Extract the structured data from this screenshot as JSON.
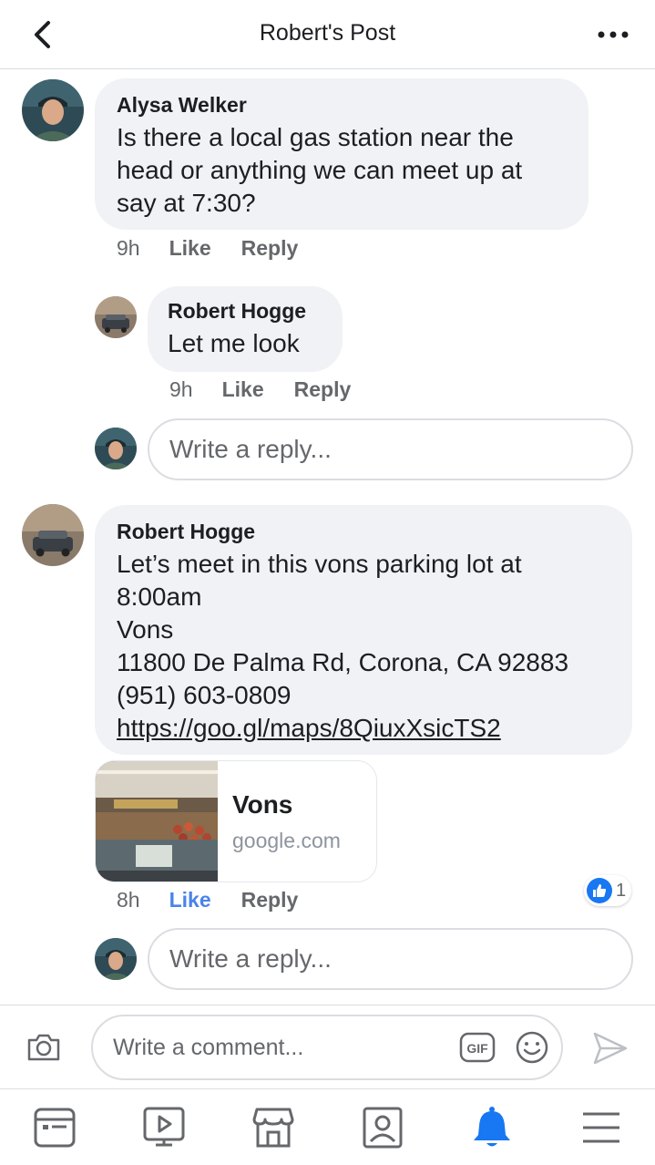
{
  "header": {
    "title": "Robert's Post",
    "back_icon": "chevron-left-icon",
    "more_icon": "more-dots-icon"
  },
  "comments": [
    {
      "author": "Alysa Welker",
      "lines": [
        "Is there a local gas station near the",
        "head or anything we can meet up at",
        "say at 7:30?"
      ],
      "time": "9h",
      "like_label": "Like",
      "reply_label": "Reply",
      "replies": [
        {
          "author": "Robert Hogge",
          "text": "Let me look",
          "time": "9h",
          "like_label": "Like",
          "reply_label": "Reply"
        }
      ],
      "reply_placeholder": "Write a reply..."
    },
    {
      "author": "Robert Hogge",
      "lines": [
        "Let’s meet in this vons parking lot at",
        "8:00am",
        "Vons",
        "11800 De Palma Rd, Corona, CA 92883",
        "(951) 603-0809"
      ],
      "link": "https://goo.gl/maps/8QiuxXsicTS2",
      "link_preview": {
        "title": "Vons",
        "domain": "google.com"
      },
      "time": "8h",
      "like_label": "Like",
      "liked": true,
      "reply_label": "Reply",
      "reaction_count": "1",
      "reply_placeholder": "Write a reply..."
    }
  ],
  "composer": {
    "placeholder": "Write a comment...",
    "gif_label": "GIF"
  },
  "tabbar": {
    "items": [
      "news-feed-icon",
      "watch-icon",
      "marketplace-icon",
      "profile-icon",
      "notifications-icon",
      "menu-icon"
    ],
    "active": "notifications-icon"
  },
  "colors": {
    "accent": "#1877f2",
    "liked": "#4a83ea",
    "bubble": "#f0f2f5",
    "meta": "#65676b"
  }
}
